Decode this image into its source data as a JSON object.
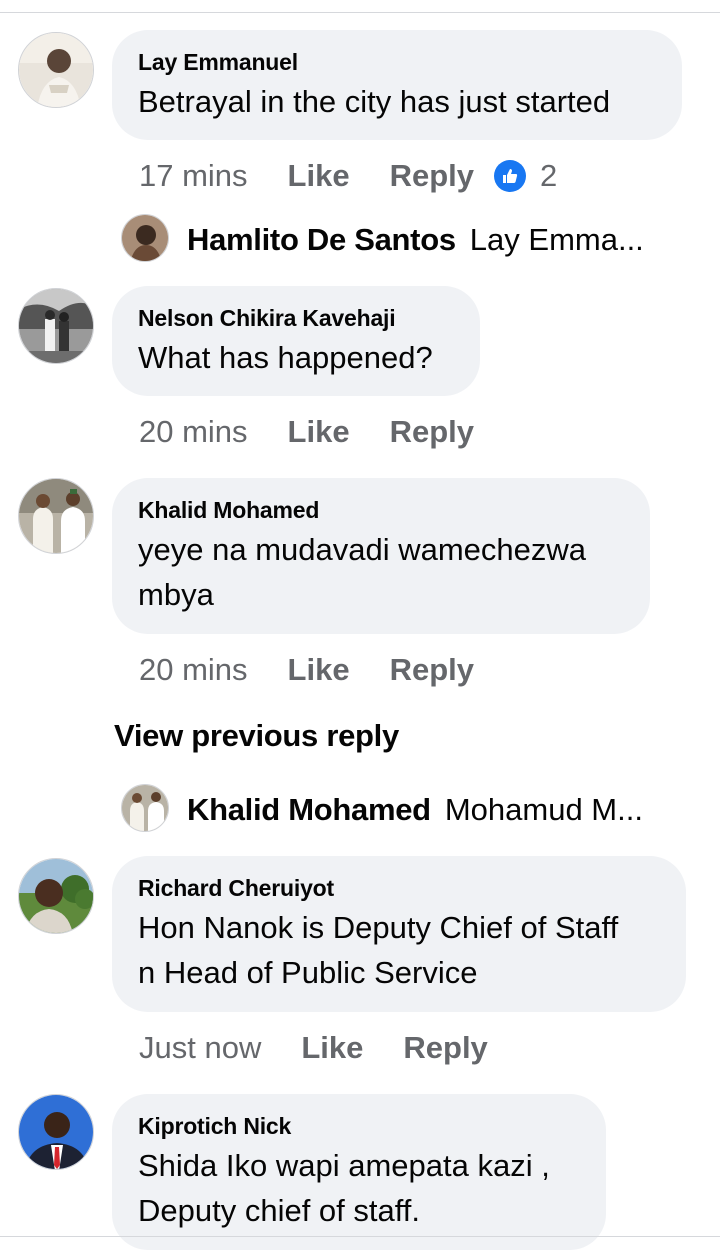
{
  "comments": [
    {
      "author": "Lay Emmanuel",
      "text": "Betrayal in the city has just started",
      "time": "17 mins",
      "like_label": "Like",
      "reply_label": "Reply",
      "reaction_count": "2",
      "reply_preview": {
        "author": "Hamlito De Santos",
        "text": "Lay Emma..."
      }
    },
    {
      "author": "Nelson Chikira Kavehaji",
      "text": "What has happened?",
      "time": "20 mins",
      "like_label": "Like",
      "reply_label": "Reply"
    },
    {
      "author": "Khalid Mohamed",
      "text_line1": "yeye na mudavadi wamechezwa",
      "text_line2": "mbya",
      "time": "20 mins",
      "like_label": "Like",
      "reply_label": "Reply",
      "view_previous_label": "View previous reply",
      "reply_preview": {
        "author": "Khalid Mohamed",
        "text": "Mohamud M..."
      }
    },
    {
      "author": "Richard Cheruiyot",
      "text_line1": "Hon Nanok is Deputy Chief of Staff",
      "text_line2": "n Head of Public Service",
      "time": "Just now",
      "like_label": "Like",
      "reply_label": "Reply"
    },
    {
      "author": "Kiprotich Nick",
      "text_line1": "Shida Iko wapi amepata kazi ,",
      "text_line2": "Deputy chief of staff.",
      "time": "",
      "like_label": "",
      "reply_label": ""
    }
  ],
  "icons": {
    "reaction": "like-thumb-icon"
  },
  "colors": {
    "bubble": "#f0f2f5",
    "meta_text": "#65676b",
    "like_blue": "#1877f2"
  }
}
